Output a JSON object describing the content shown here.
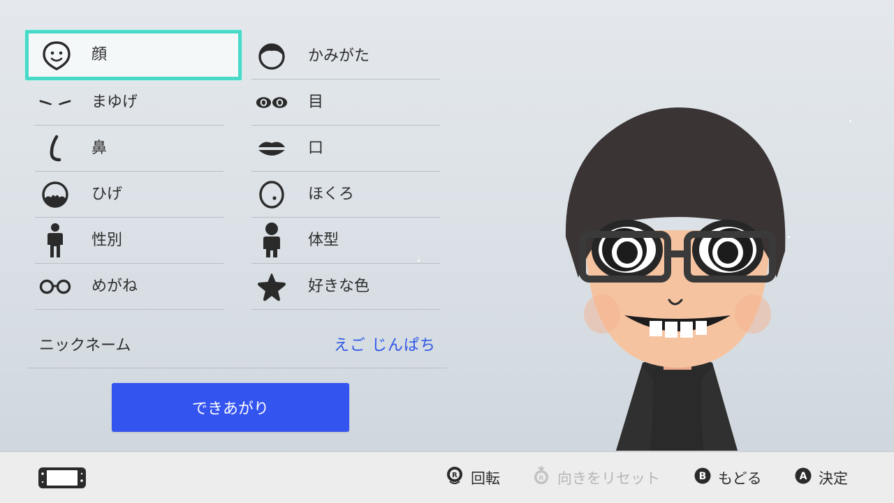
{
  "menu": {
    "left": [
      {
        "label": "顔",
        "icon": "face-icon"
      },
      {
        "label": "まゆげ",
        "icon": "eyebrows-icon"
      },
      {
        "label": "鼻",
        "icon": "nose-icon"
      },
      {
        "label": "ひげ",
        "icon": "beard-icon"
      },
      {
        "label": "性別",
        "icon": "gender-icon"
      },
      {
        "label": "めがね",
        "icon": "glasses-icon"
      }
    ],
    "right": [
      {
        "label": "かみがた",
        "icon": "hairstyle-icon"
      },
      {
        "label": "目",
        "icon": "eyes-icon"
      },
      {
        "label": "口",
        "icon": "mouth-icon"
      },
      {
        "label": "ほくろ",
        "icon": "mole-icon"
      },
      {
        "label": "体型",
        "icon": "body-type-icon"
      },
      {
        "label": "好きな色",
        "icon": "favorite-color-icon"
      }
    ],
    "selected": "顔"
  },
  "nickname": {
    "label": "ニックネーム",
    "value": "えご じんぱち"
  },
  "done_button": {
    "label": "できあがり"
  },
  "footer": {
    "hints": [
      {
        "button": "R",
        "label": "回転",
        "enabled": true
      },
      {
        "button": "R",
        "label": "向きをリセット",
        "enabled": false
      },
      {
        "button": "B",
        "label": "もどる",
        "enabled": true
      },
      {
        "button": "A",
        "label": "決定",
        "enabled": true
      }
    ]
  },
  "colors": {
    "accent_blue": "#3454f0",
    "selection_teal": "#49d9c8",
    "nickname_blue": "#2f56e8"
  }
}
